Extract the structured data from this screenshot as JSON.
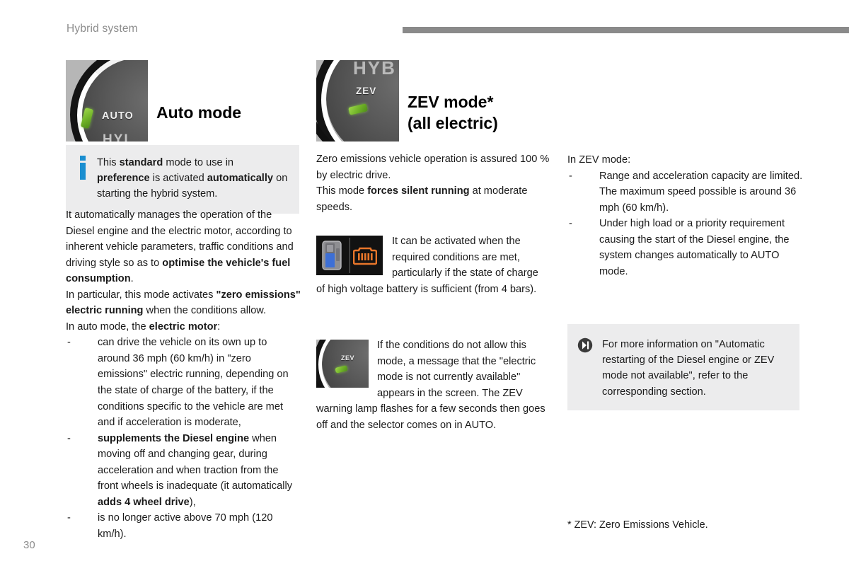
{
  "header": {
    "title": "Hybrid system",
    "rule_color": "#8a8a8a"
  },
  "page_number": "30",
  "colors": {
    "info_blue": "#1a8ed0",
    "callout_bg": "#ececed",
    "header_gray": "#8c8c8c",
    "led_green": "#6fb227"
  },
  "left_column": {
    "image": {
      "name": "auto-mode-selector-dial",
      "dial_label": "AUTO",
      "dial_label_secondary": "HYI"
    },
    "title": "Auto mode",
    "info_callout": {
      "icon": "info-icon",
      "html": "This <b>standard</b> mode to use in <b>preference</b> is activated <b>automatically</b> on starting the hybrid system."
    },
    "paragraph_1_html": "It automatically manages the operation of the Diesel engine and the electric motor, according to inherent vehicle parameters, traffic conditions and driving style so as to <b>optimise the vehicle's fuel consumption</b>.",
    "paragraph_2_html": "In particular, this mode activates <b>\"zero emissions\" electric running</b> when the conditions allow.",
    "paragraph_3_html": "In auto mode, the <b>electric motor</b>:",
    "bullets": [
      {
        "dash": "-",
        "html": "can drive the vehicle on its own up to around 36 mph (60 km/h) in \"zero emissions\" electric running, depending on the state of charge of the battery, if the conditions specific to the vehicle are met and if acceleration is moderate,"
      },
      {
        "dash": "-",
        "html": "<b>supplements the Diesel engine</b> when moving off and changing gear, during acceleration and when traction from the front wheels is inadequate (it automatically <b>adds 4 wheel drive</b>),"
      },
      {
        "dash": "-",
        "html": "is no longer active above 70 mph (120 km/h)."
      }
    ]
  },
  "middle_column": {
    "image": {
      "name": "zev-mode-selector-dial",
      "dial_label": "ZEV",
      "dial_label_secondary": "HYB"
    },
    "title_line_1": "ZEV mode*",
    "title_line_2": "(all electric)",
    "paragraph_1_html": "Zero emissions vehicle operation is assured 100 % by electric drive.",
    "paragraph_2_html": "This mode <b>forces silent running</b> at moderate speeds.",
    "battery_block": {
      "image_name": "battery-charge-level-icons",
      "html": "It can be activated when the required conditions are met, particularly if the state of charge of high voltage battery is sufficient (from 4 bars)."
    },
    "unavailable_block": {
      "image_name": "zev-mode-selector-dial-small",
      "dial_label": "ZEV",
      "html": "If the conditions do not allow this mode, a message that the \"electric mode is not currently available\" appears in the screen. The ZEV warning lamp flashes for a few seconds then goes off and the selector comes on in AUTO."
    }
  },
  "right_column": {
    "intro": "In ZEV mode:",
    "bullets": [
      {
        "dash": "-",
        "html": "Range and acceleration capacity are limited. The maximum speed possible is around 36 mph (60 km/h)."
      },
      {
        "dash": "-",
        "html": "Under high load or a priority requirement causing the start of the Diesel engine, the system changes automatically to AUTO mode."
      }
    ],
    "reference_callout": {
      "icon": "next-section-icon",
      "html": "For more information on \"Automatic restarting of the Diesel engine or ZEV mode not available\", refer to the corresponding section."
    },
    "footnote": "* ZEV: Zero Emissions Vehicle."
  }
}
